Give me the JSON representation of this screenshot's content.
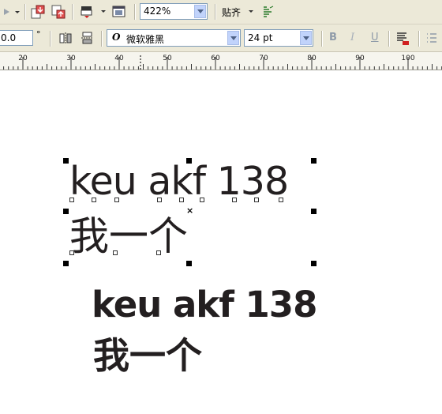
{
  "toolbar": {
    "zoom_value": "422%",
    "snap_label": "贴齐"
  },
  "property_bar": {
    "angle_value": "0.0",
    "degree_symbol": "°",
    "font_glyph": "O",
    "font_name": "微软雅黑",
    "font_size": "24 pt",
    "bold_label": "B",
    "italic_label": "I",
    "underline_label": "U"
  },
  "ruler": {
    "labels": [
      "20",
      "30",
      "40",
      "50",
      "60",
      "70",
      "80",
      "90",
      "100"
    ]
  },
  "canvas": {
    "selected_text_line1": "keu akf 138",
    "selected_text_line2": "我一个",
    "bold_text_line1": "keu akf 138",
    "bold_text_line2": "我一个"
  },
  "colors": {
    "toolbar_bg": "#ece9d8",
    "text_color": "#231f20",
    "combo_drop": "#c1d3fb"
  }
}
